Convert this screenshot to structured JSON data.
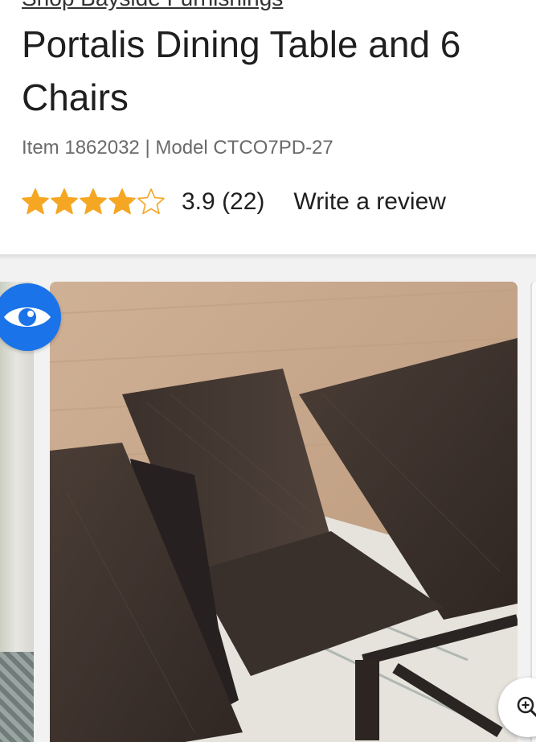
{
  "header": {
    "brand_link": "Shop Bayside Furnishings",
    "title": "Portalis Dining Table and 6 Chairs",
    "item_meta": "Item 1862032 | Model CTCO7PD-27",
    "rating": {
      "value": 3.9,
      "value_text": "3.9",
      "count_text": "(22)",
      "review_link": "Write a review",
      "star_color": "#f5a623"
    }
  },
  "gallery": {
    "main_image_alt": "Portalis Dining Table extension leaf",
    "view_icon": "eye-icon",
    "zoom_icon": "zoom-in-icon",
    "accent_color": "#1a73e8"
  }
}
